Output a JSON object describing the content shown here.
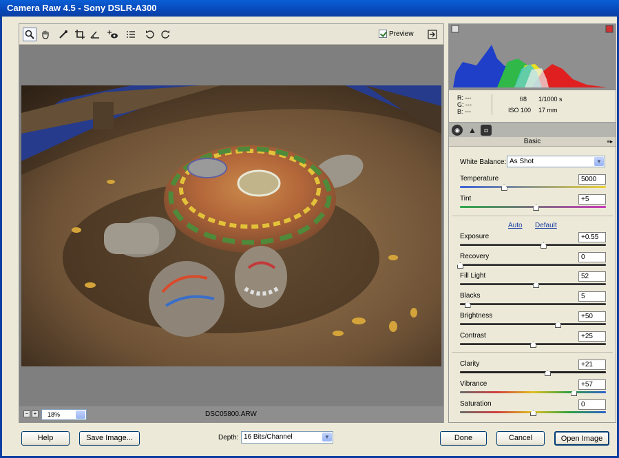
{
  "window": {
    "title": "Camera Raw 4.5  -  Sony DSLR-A300"
  },
  "toolbar": {
    "tools": [
      "zoom-icon",
      "hand-icon",
      "white-balance-icon",
      "crop-icon",
      "straighten-icon",
      "red-eye-icon",
      "preferences-icon",
      "rotate-left-icon",
      "rotate-right-icon"
    ],
    "preview_label": "Preview",
    "preview_checked": true
  },
  "status": {
    "zoom_value": "18%",
    "filename": "DSC05800.ARW"
  },
  "histogram": {
    "rgb": {
      "r": "R:  ---",
      "g": "G:  ---",
      "b": "B:  ---"
    },
    "aperture": "f/8",
    "shutter": "1/1000 s",
    "iso": "ISO 100",
    "focal": "17 mm"
  },
  "panel": {
    "section_title": "Basic",
    "white_balance_label": "White Balance:",
    "white_balance_value": "As Shot",
    "auto_label": "Auto",
    "default_label": "Default",
    "sliders": [
      {
        "label": "Temperature",
        "value": "5000",
        "pos": 0.3
      },
      {
        "label": "Tint",
        "value": "+5",
        "pos": 0.52
      },
      {
        "label": "Exposure",
        "value": "+0.55",
        "pos": 0.57
      },
      {
        "label": "Recovery",
        "value": "0",
        "pos": 0.0
      },
      {
        "label": "Fill Light",
        "value": "52",
        "pos": 0.52
      },
      {
        "label": "Blacks",
        "value": "5",
        "pos": 0.05
      },
      {
        "label": "Brightness",
        "value": "+50",
        "pos": 0.67
      },
      {
        "label": "Contrast",
        "value": "+25",
        "pos": 0.5
      },
      {
        "label": "Clarity",
        "value": "+21",
        "pos": 0.6
      },
      {
        "label": "Vibrance",
        "value": "+57",
        "pos": 0.78
      },
      {
        "label": "Saturation",
        "value": "0",
        "pos": 0.5
      }
    ]
  },
  "bottom": {
    "help_label": "Help",
    "save_label": "Save Image...",
    "depth_label": "Depth:",
    "depth_value": "16 Bits/Channel",
    "done_label": "Done",
    "cancel_label": "Cancel",
    "open_label": "Open Image"
  }
}
